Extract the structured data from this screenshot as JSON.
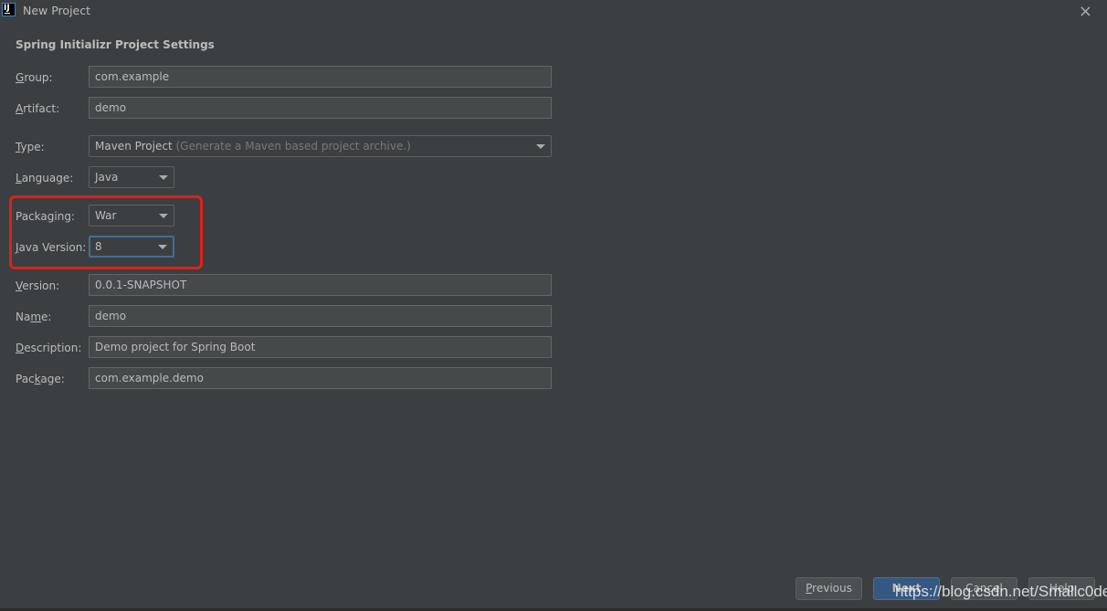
{
  "window": {
    "title": "New Project",
    "app_icon_text": "IJ",
    "close_icon": "×"
  },
  "section_title": "Spring Initializr Project Settings",
  "fields": {
    "group": {
      "label_mnemonic": "G",
      "label_rest": "roup:",
      "value": "com.example"
    },
    "artifact": {
      "label_mnemonic": "A",
      "label_rest": "rtifact:",
      "value": "demo"
    },
    "type": {
      "label_mnemonic": "T",
      "label_rest": "ype:",
      "value": "Maven Project",
      "hint": "(Generate a Maven based project archive.)"
    },
    "language": {
      "label_mnemonic": "L",
      "label_rest": "anguage:",
      "value": "Java"
    },
    "packaging": {
      "label_pre": "Packa",
      "label_mnemonic": "g",
      "label_rest": "ing:",
      "value": "War"
    },
    "java_version": {
      "label_mnemonic": "J",
      "label_rest": "ava Version:",
      "value": "8"
    },
    "version": {
      "label_mnemonic": "V",
      "label_rest": "ersion:",
      "value": "0.0.1-SNAPSHOT"
    },
    "name": {
      "label_pre": "Na",
      "label_mnemonic": "m",
      "label_rest": "e:",
      "value": "demo"
    },
    "description": {
      "label_mnemonic": "D",
      "label_rest": "escription:",
      "value": "Demo project for Spring Boot"
    },
    "package": {
      "label_pre": "Pac",
      "label_mnemonic": "k",
      "label_rest": "age:",
      "value": "com.example.demo"
    }
  },
  "buttons": {
    "previous": {
      "mnemonic": "P",
      "rest": "revious"
    },
    "next": "Next",
    "cancel": "Cancel",
    "help": "Help"
  },
  "watermark": "https://blog.csdn.net/Smallc0de",
  "colors": {
    "background": "#3c3f41",
    "field_bg": "#45494a",
    "focus_border": "#466d94",
    "annotation_red": "#e0201a",
    "primary_button": "#365880"
  }
}
